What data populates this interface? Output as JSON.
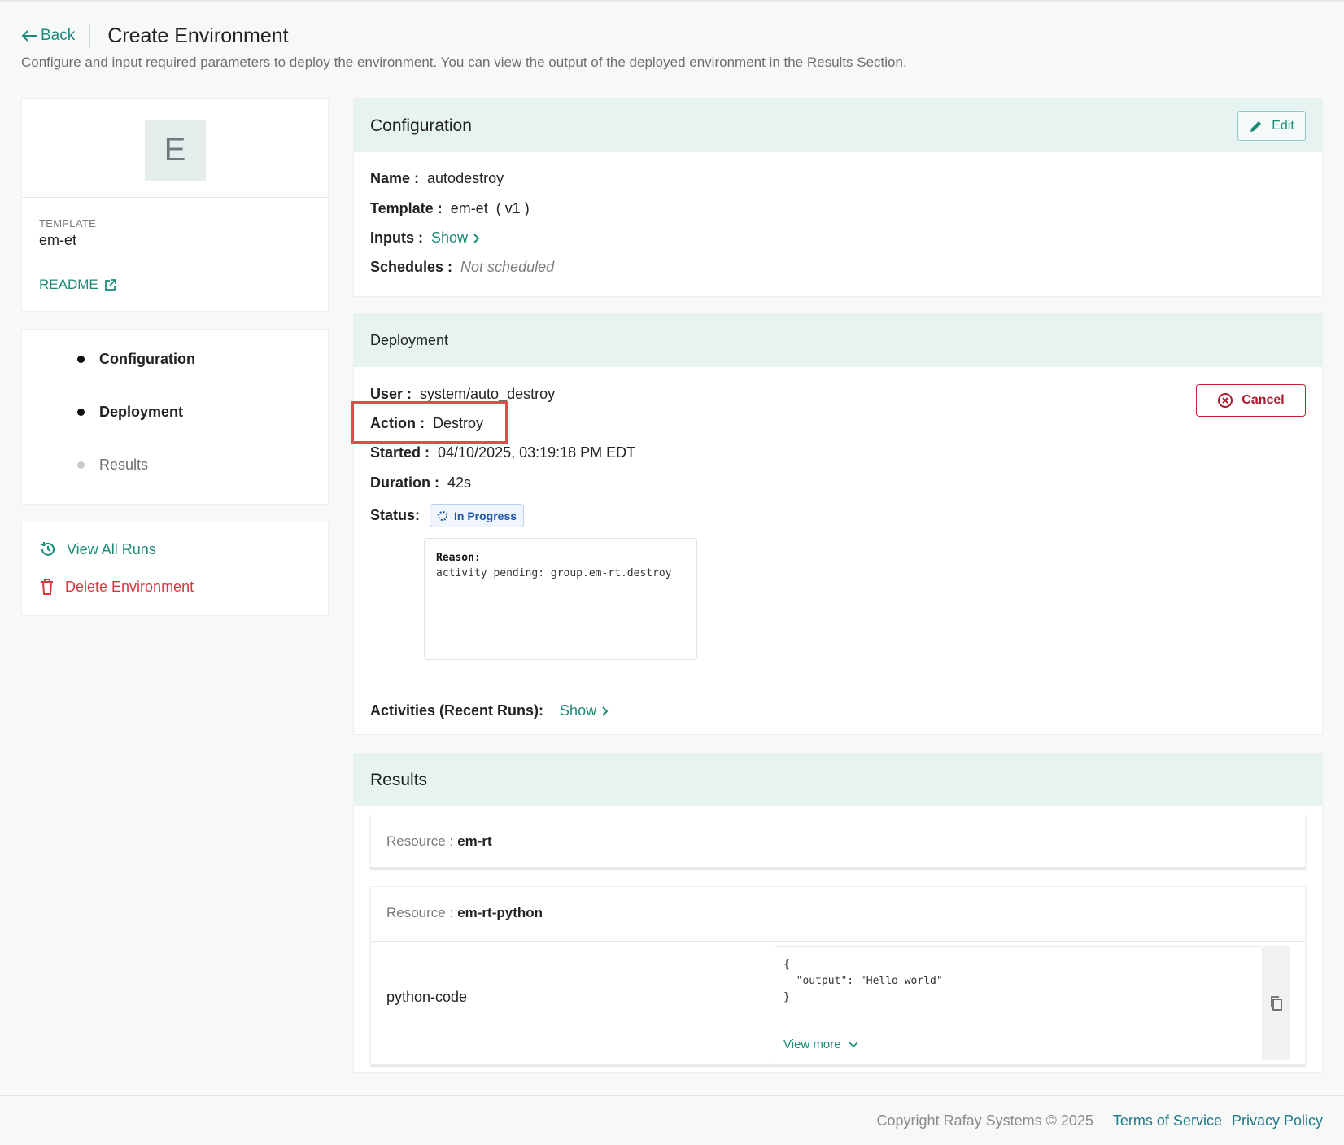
{
  "header": {
    "back_label": "Back",
    "title": "Create Environment",
    "subtitle": "Configure and input required parameters to deploy the environment. You can view the output of the deployed environment in the Results Section."
  },
  "template_card": {
    "avatar_letter": "E",
    "caption": "TEMPLATE",
    "name": "em-et",
    "readme_label": "README"
  },
  "steps": [
    {
      "label": "Configuration",
      "state": "active"
    },
    {
      "label": "Deployment",
      "state": "active"
    },
    {
      "label": "Results",
      "state": "inactive"
    }
  ],
  "actions": {
    "view_all_runs": "View All Runs",
    "delete_environment": "Delete Environment"
  },
  "configuration": {
    "title": "Configuration",
    "edit_label": "Edit",
    "name_key": "Name :",
    "name_value": "autodestroy",
    "template_key": "Template :",
    "template_value": "em-et  ( v1 )",
    "inputs_key": "Inputs :",
    "inputs_link": "Show",
    "schedules_key": "Schedules :",
    "schedules_value": "Not scheduled"
  },
  "deployment": {
    "title": "Deployment",
    "cancel_label": "Cancel",
    "user_key": "User :",
    "user_value": "system/auto_destroy",
    "action_key": "Action :",
    "action_value": "Destroy",
    "started_key": "Started :",
    "started_value": "04/10/2025, 03:19:18 PM EDT",
    "duration_key": "Duration :",
    "duration_value": "42s",
    "status_key": "Status:",
    "status_value": "In Progress",
    "reason_key": "Reason:",
    "reason_value": "activity pending: group.em-rt.destroy",
    "activities_key": "Activities (Recent Runs):",
    "activities_link": "Show"
  },
  "results": {
    "title": "Results",
    "resources": [
      {
        "key": "Resource :",
        "name": "em-rt"
      },
      {
        "key": "Resource :",
        "name": "em-rt-python"
      }
    ],
    "output_label": "python-code",
    "output_code": "{\n  \"output\": \"Hello world\"\n}",
    "view_more": "View more"
  },
  "footer": {
    "copyright": "Copyright Rafay Systems © 2025",
    "terms": "Terms of Service",
    "privacy": "Privacy Policy"
  },
  "colors": {
    "accent": "#1d8a78",
    "section_header_bg": "#e7f3f1",
    "danger": "#b0182e",
    "status_blue": "#1f55a8"
  }
}
